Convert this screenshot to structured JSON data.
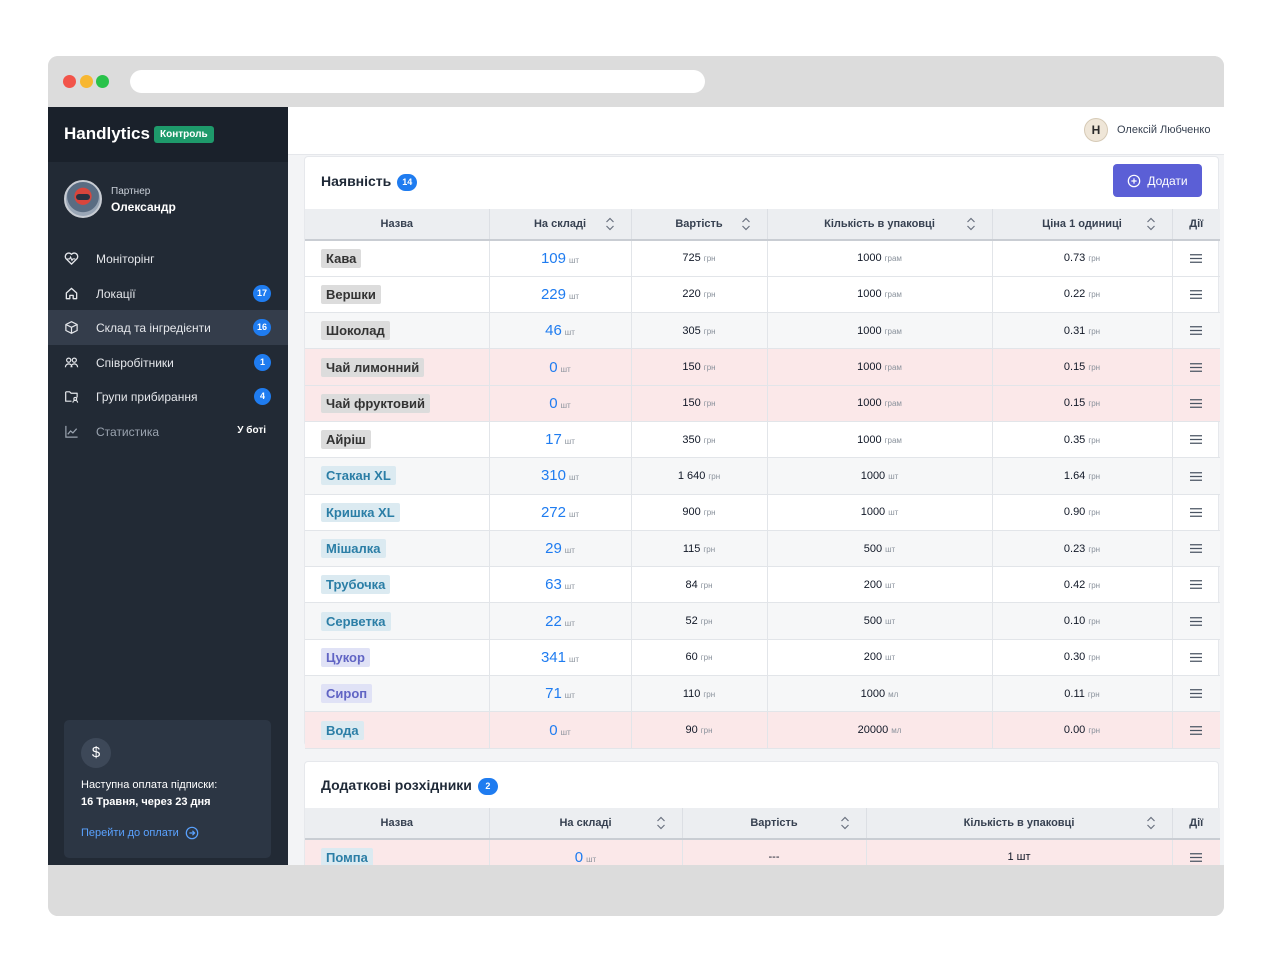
{
  "sidebar": {
    "brand": "Handlytics",
    "brand_badge": "Контроль",
    "profile": {
      "role": "Партнер",
      "name": "Олександр"
    },
    "items": [
      {
        "label": "Моніторінг",
        "icon": "heart-pulse-icon",
        "badge": ""
      },
      {
        "label": "Локації",
        "icon": "home-icon",
        "badge": "17"
      },
      {
        "label": "Склад та інгредієнти",
        "icon": "box-icon",
        "badge": "16",
        "active": true
      },
      {
        "label": "Співробітники",
        "icon": "users-icon",
        "badge": "1"
      },
      {
        "label": "Групи прибирання",
        "icon": "folder-user-icon",
        "badge": "4"
      },
      {
        "label": "Статистика",
        "icon": "chart-line-icon",
        "tag": "У боті",
        "muted": true
      }
    ],
    "billing": {
      "icon": "$",
      "line1": "Наступна оплата підписки:",
      "line2": "16 Травня, через 23 дня",
      "link": "Перейти до оплати"
    }
  },
  "header": {
    "avatar_letter": "H",
    "user_name": "Олексій Любченко"
  },
  "inventory": {
    "title": "Наявність",
    "count": "14",
    "add_label": "Додати",
    "columns": [
      "Назва",
      "На складі",
      "Вартість",
      "Кількість в упаковці",
      "Ціна 1 одиниці",
      "Дії"
    ],
    "rows": [
      {
        "name": "Кава",
        "chip": "grey",
        "row": "white",
        "stock": "109",
        "stock_unit": "шт",
        "cost": "725",
        "cost_unit": "грн",
        "pack": "1000",
        "pack_unit": "грам",
        "unit_price": "0.73",
        "price_unit": "грн"
      },
      {
        "name": "Вершки",
        "chip": "grey",
        "row": "white",
        "stock": "229",
        "stock_unit": "шт",
        "cost": "220",
        "cost_unit": "грн",
        "pack": "1000",
        "pack_unit": "грам",
        "unit_price": "0.22",
        "price_unit": "грн"
      },
      {
        "name": "Шоколад",
        "chip": "grey",
        "row": "grey",
        "stock": "46",
        "stock_unit": "шт",
        "cost": "305",
        "cost_unit": "грн",
        "pack": "1000",
        "pack_unit": "грам",
        "unit_price": "0.31",
        "price_unit": "грн"
      },
      {
        "name": "Чай лимонний",
        "chip": "grey",
        "row": "pink",
        "stock": "0",
        "stock_unit": "шт",
        "cost": "150",
        "cost_unit": "грн",
        "pack": "1000",
        "pack_unit": "грам",
        "unit_price": "0.15",
        "price_unit": "грн"
      },
      {
        "name": "Чай фруктовий",
        "chip": "grey",
        "row": "pink",
        "stock": "0",
        "stock_unit": "шт",
        "cost": "150",
        "cost_unit": "грн",
        "pack": "1000",
        "pack_unit": "грам",
        "unit_price": "0.15",
        "price_unit": "грн"
      },
      {
        "name": "Айріш",
        "chip": "grey",
        "row": "white",
        "stock": "17",
        "stock_unit": "шт",
        "cost": "350",
        "cost_unit": "грн",
        "pack": "1000",
        "pack_unit": "грам",
        "unit_price": "0.35",
        "price_unit": "грн"
      },
      {
        "name": "Стакан XL",
        "chip": "blue",
        "row": "grey",
        "stock": "310",
        "stock_unit": "шт",
        "cost": "1 640",
        "cost_unit": "грн",
        "pack": "1000",
        "pack_unit": "шт",
        "unit_price": "1.64",
        "price_unit": "грн"
      },
      {
        "name": "Кришка XL",
        "chip": "blue",
        "row": "white",
        "stock": "272",
        "stock_unit": "шт",
        "cost": "900",
        "cost_unit": "грн",
        "pack": "1000",
        "pack_unit": "шт",
        "unit_price": "0.90",
        "price_unit": "грн"
      },
      {
        "name": "Мішалка",
        "chip": "blue",
        "row": "grey",
        "stock": "29",
        "stock_unit": "шт",
        "cost": "115",
        "cost_unit": "грн",
        "pack": "500",
        "pack_unit": "шт",
        "unit_price": "0.23",
        "price_unit": "грн"
      },
      {
        "name": "Трубочка",
        "chip": "blue",
        "row": "white",
        "stock": "63",
        "stock_unit": "шт",
        "cost": "84",
        "cost_unit": "грн",
        "pack": "200",
        "pack_unit": "шт",
        "unit_price": "0.42",
        "price_unit": "грн"
      },
      {
        "name": "Серветка",
        "chip": "blue",
        "row": "grey",
        "stock": "22",
        "stock_unit": "шт",
        "cost": "52",
        "cost_unit": "грн",
        "pack": "500",
        "pack_unit": "шт",
        "unit_price": "0.10",
        "price_unit": "грн"
      },
      {
        "name": "Цукор",
        "chip": "violet",
        "row": "white",
        "stock": "341",
        "stock_unit": "шт",
        "cost": "60",
        "cost_unit": "грн",
        "pack": "200",
        "pack_unit": "шт",
        "unit_price": "0.30",
        "price_unit": "грн"
      },
      {
        "name": "Сироп",
        "chip": "violet",
        "row": "grey",
        "stock": "71",
        "stock_unit": "шт",
        "cost": "110",
        "cost_unit": "грн",
        "pack": "1000",
        "pack_unit": "мл",
        "unit_price": "0.11",
        "price_unit": "грн"
      },
      {
        "name": "Вода",
        "chip": "blue",
        "row": "pink",
        "stock": "0",
        "stock_unit": "шт",
        "cost": "90",
        "cost_unit": "грн",
        "pack": "20000",
        "pack_unit": "мл",
        "unit_price": "0.00",
        "price_unit": "грн"
      }
    ]
  },
  "extra": {
    "title": "Додаткові розхідники",
    "count": "2",
    "columns": [
      "Назва",
      "На складі",
      "Вартість",
      "Кількість в упаковці",
      "Дії"
    ],
    "rows": [
      {
        "name": "Помпа",
        "chip": "blue",
        "row": "pink",
        "stock": "0",
        "stock_unit": "шт",
        "cost": "---",
        "pack": "1 шт"
      }
    ]
  }
}
